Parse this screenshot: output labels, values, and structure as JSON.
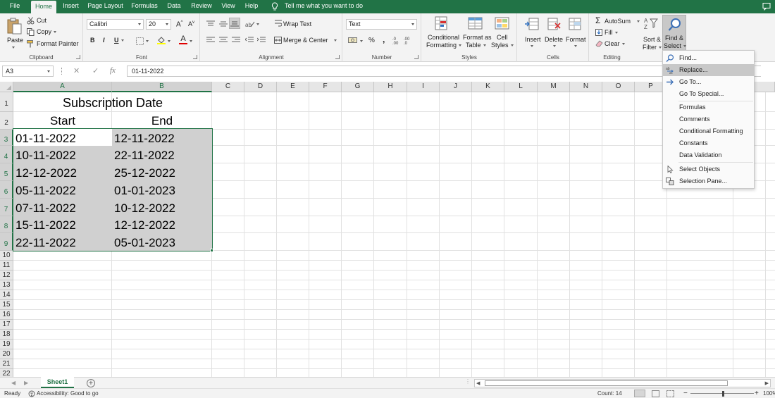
{
  "menu_tabs": [
    "File",
    "Home",
    "Insert",
    "Page Layout",
    "Formulas",
    "Data",
    "Review",
    "View",
    "Help"
  ],
  "active_tab": "Home",
  "tell_me": "Tell me what you want to do",
  "ribbon": {
    "clipboard": {
      "paste": "Paste",
      "cut": "Cut",
      "copy": "Copy",
      "format_painter": "Format Painter",
      "label": "Clipboard"
    },
    "font": {
      "name": "Calibri",
      "size": "20",
      "bold": "B",
      "italic": "I",
      "underline": "U",
      "grow": "A",
      "shrink": "A",
      "color_letter": "A",
      "label": "Font"
    },
    "alignment": {
      "wrap_text": "Wrap Text",
      "merge_center": "Merge & Center",
      "label": "Alignment"
    },
    "number": {
      "format": "Text",
      "percent": "%",
      "comma": ",",
      "label": "Number"
    },
    "styles": {
      "conditional_1": "Conditional",
      "conditional_2": "Formatting",
      "format_table_1": "Format as",
      "format_table_2": "Table",
      "cell_styles_1": "Cell",
      "cell_styles_2": "Styles",
      "label": "Styles"
    },
    "cells": {
      "insert": "Insert",
      "delete": "Delete",
      "format": "Format",
      "label": "Cells"
    },
    "editing": {
      "autosum": "AutoSum",
      "fill": "Fill",
      "clear": "Clear",
      "sort_1": "Sort &",
      "sort_2": "Filter",
      "find_1": "Find &",
      "find_2": "Select",
      "label": "Editing"
    }
  },
  "formula_bar": {
    "name_box": "A3",
    "formula": "01-11-2022",
    "cancel": "✕",
    "enter": "✓",
    "fx": "fx"
  },
  "columns": [
    "A",
    "B",
    "C",
    "D",
    "E",
    "F",
    "G",
    "H",
    "I",
    "J",
    "K",
    "L",
    "M",
    "N",
    "O",
    "P"
  ],
  "rows": [
    "1",
    "2",
    "3",
    "4",
    "5",
    "6",
    "7",
    "8",
    "9",
    "10",
    "11",
    "12",
    "13",
    "14",
    "15",
    "16",
    "17",
    "18",
    "19",
    "20",
    "21",
    "22"
  ],
  "sheet": {
    "title": "Subscription Date",
    "headers": [
      "Start",
      "End"
    ],
    "data": [
      [
        "01-11-2022",
        "12-11-2022"
      ],
      [
        "10-11-2022",
        "22-11-2022"
      ],
      [
        "12-12-2022",
        "25-12-2022"
      ],
      [
        "05-11-2022",
        "01-01-2023"
      ],
      [
        "07-11-2022",
        "10-12-2022"
      ],
      [
        "15-11-2022",
        "12-12-2022"
      ],
      [
        "22-11-2022",
        "05-01-2023"
      ]
    ]
  },
  "find_menu": [
    {
      "label": "Find...",
      "icon": "search-icon"
    },
    {
      "label": "Replace...",
      "icon": "replace-icon",
      "highlighted": true
    },
    {
      "label": "Go To...",
      "icon": "arrow-right-icon"
    },
    {
      "label": "Go To Special...",
      "icon": ""
    },
    {
      "label": "Formulas",
      "icon": ""
    },
    {
      "label": "Comments",
      "icon": ""
    },
    {
      "label": "Conditional Formatting",
      "icon": ""
    },
    {
      "label": "Constants",
      "icon": ""
    },
    {
      "label": "Data Validation",
      "icon": ""
    },
    {
      "label": "Select Objects",
      "icon": "cursor-icon"
    },
    {
      "label": "Selection Pane...",
      "icon": "selection-pane-icon"
    }
  ],
  "sheet_tabs": [
    "Sheet1"
  ],
  "status": {
    "ready": "Ready",
    "accessibility": "Accessibility: Good to go",
    "count": "Count: 14",
    "zoom": "100%"
  },
  "colors": {
    "excel_green": "#217346",
    "selection_fill": "#d0d0d0",
    "menu_highlight": "#c8c8c8"
  }
}
